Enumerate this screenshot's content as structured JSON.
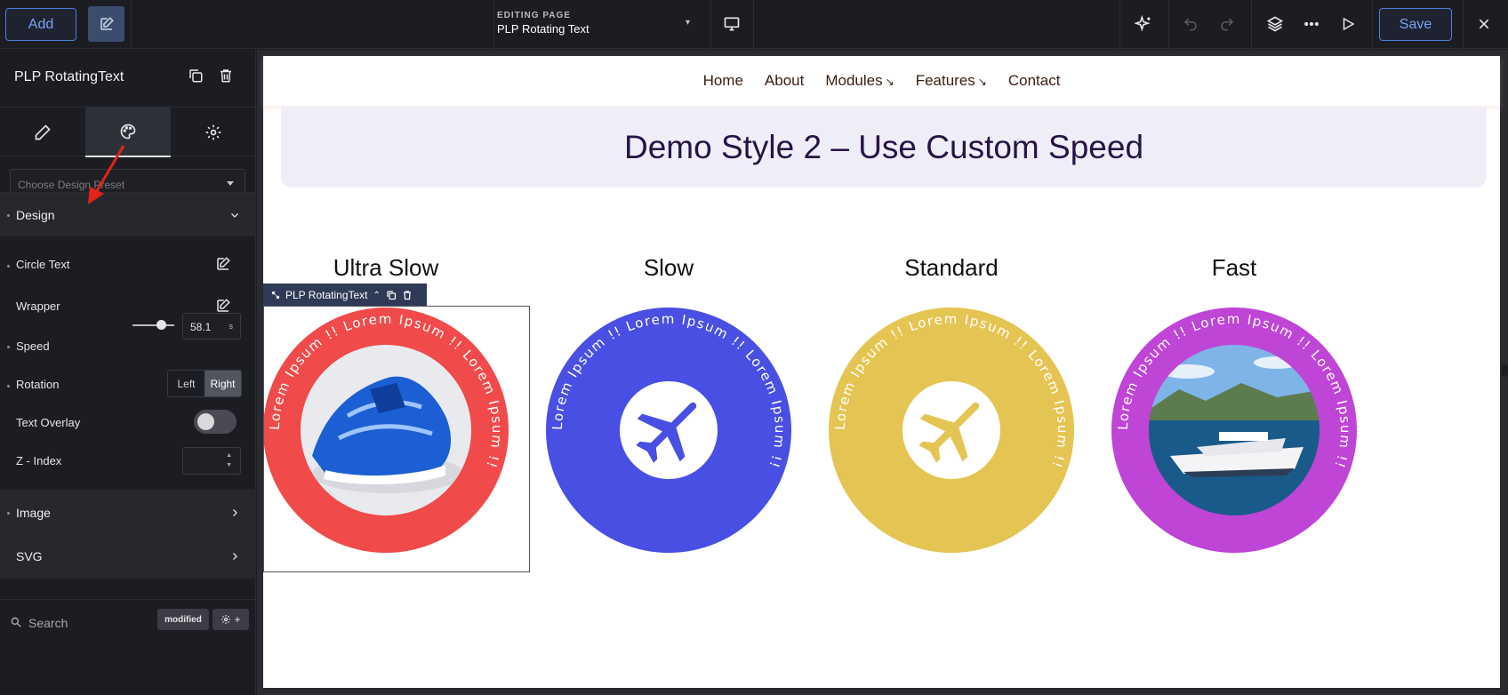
{
  "topbar": {
    "add_label": "Add",
    "editing_label": "EDITING PAGE",
    "page_name": "PLP Rotating Text",
    "save_label": "Save"
  },
  "panel": {
    "module_title": "PLP RotatingText",
    "preset_placeholder": "Choose Design Preset",
    "sections": {
      "design": "Design",
      "image": "Image",
      "svg": "SVG"
    },
    "rows": {
      "circle_text": "Circle Text",
      "wrapper": "Wrapper",
      "speed": "Speed",
      "rotation": "Rotation",
      "text_overlay": "Text Overlay",
      "z_index": "Z - Index"
    },
    "speed_value": "58.1",
    "speed_unit": "s",
    "speed_slider_fraction": 0.55,
    "rotation_options": [
      "Left",
      "Right"
    ],
    "rotation_selected": "Right",
    "text_overlay_on": false,
    "search_placeholder": "Search",
    "modified_badge": "modified"
  },
  "page": {
    "nav": [
      "Home",
      "About",
      "Modules",
      "Features",
      "Contact"
    ],
    "nav_dropdown_arrow": "↘",
    "hero_title": "Demo Style 2 – Use Custom Speed",
    "selected_module_label": "PLP RotatingText",
    "circle_text": "Lorem Ipsum !! Lorem Ipsum !! Lorem Ipsum !! ",
    "items": [
      {
        "title": "Ultra Slow",
        "color": "#f04a4a",
        "center": "sneaker-image"
      },
      {
        "title": "Slow",
        "color": "#4a4fe3",
        "center": "airplane-icon"
      },
      {
        "title": "Standard",
        "color": "#e4c553",
        "center": "airplane-icon"
      },
      {
        "title": "Fast",
        "color": "#be45d6",
        "center": "yacht-image"
      }
    ]
  }
}
